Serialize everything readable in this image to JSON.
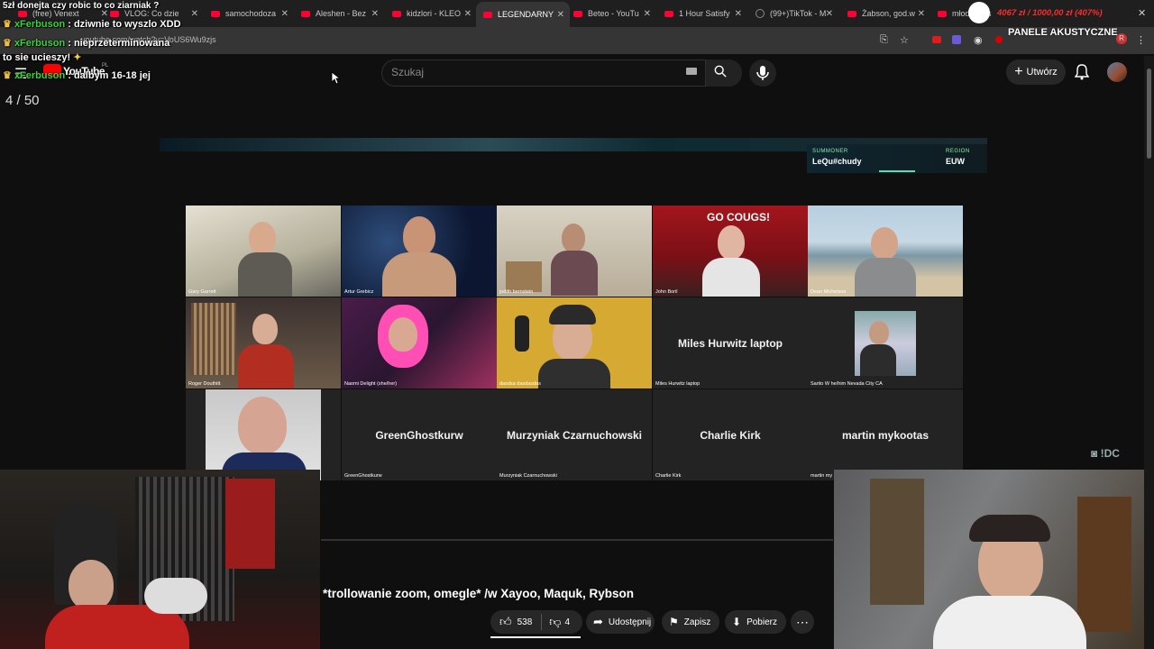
{
  "overlay": {
    "top_line": "5zł donejta czy robic to co ziarniak ?",
    "chat": [
      {
        "user": "xFerbuson",
        "text": ": dziwnie to wyszlo XDD"
      },
      {
        "user": "xFerbuson",
        "text": ": nieprzeterminowana"
      },
      {
        "user": "",
        "text": "to sie ucieszy!"
      },
      {
        "user": "xFerbuson",
        "text": ": dalbym 16-18 jej"
      }
    ],
    "panele": "PANELE AKUSTYCZNE",
    "money": "4067 zł / 1000,00 zł (407%)"
  },
  "browser": {
    "tabs": [
      {
        "label": "(free) Venext"
      },
      {
        "label": "VLOG: Co dzie"
      },
      {
        "label": "samochodoza"
      },
      {
        "label": "Aleshen - Bez"
      },
      {
        "label": "kidzlori - KLEO"
      },
      {
        "label": "LEGENDARNY",
        "active": true
      },
      {
        "label": "Beteo - YouTu"
      },
      {
        "label": "1 Hour Satisfy"
      },
      {
        "label": "(99+)TikTok - M"
      },
      {
        "label": "Żabson, god.w"
      },
      {
        "label": "młody mas"
      }
    ],
    "url": "youtube.com/watch?v=VoUS6Wu9zjs"
  },
  "youtube": {
    "logo": "YouTube",
    "logo_sup": "PL",
    "search_placeholder": "Szukaj",
    "create_label": "Utwórz",
    "video_counter": "4 / 50",
    "video_title": "*trollowanie zoom, omegle* /w Xayoo, Maquk, Rybson",
    "likes": "538",
    "dislikes": "4",
    "share": "Udostępnij",
    "save": "Zapisz",
    "download": "Pobierz"
  },
  "banner": {
    "summoner_label": "SUMMONER",
    "summoner": "LeQu#chudy",
    "region_label": "REGION",
    "region": "EUW"
  },
  "zoom": {
    "participants": [
      {
        "name": "Gary Garrett"
      },
      {
        "name": "Artur Grebicz"
      },
      {
        "name": "judith bernstein"
      },
      {
        "name": "John Boril"
      },
      {
        "name": "Dean Michelson"
      },
      {
        "name": "Roger Douthitt"
      },
      {
        "name": "Naomi Delight (she/her)"
      },
      {
        "name": "dasdsa dasdasdas"
      },
      {
        "name": "Miles Hurwitz laptop",
        "display": "Miles Hurwitz laptop"
      },
      {
        "name": "Sarito W he/him Nevada City CA"
      },
      {
        "name": ""
      },
      {
        "name": "GreenGhostkurw",
        "display": "GreenGhostkurw"
      },
      {
        "name": "Murzyniak Czarnuchowski",
        "display": "Murzyniak Czarnuchowski"
      },
      {
        "name": "Charlie Kirk",
        "display": "Charlie Kirk"
      },
      {
        "name": "martin my",
        "display": "martin mykootas"
      }
    ],
    "discord_tag": "!DC"
  }
}
